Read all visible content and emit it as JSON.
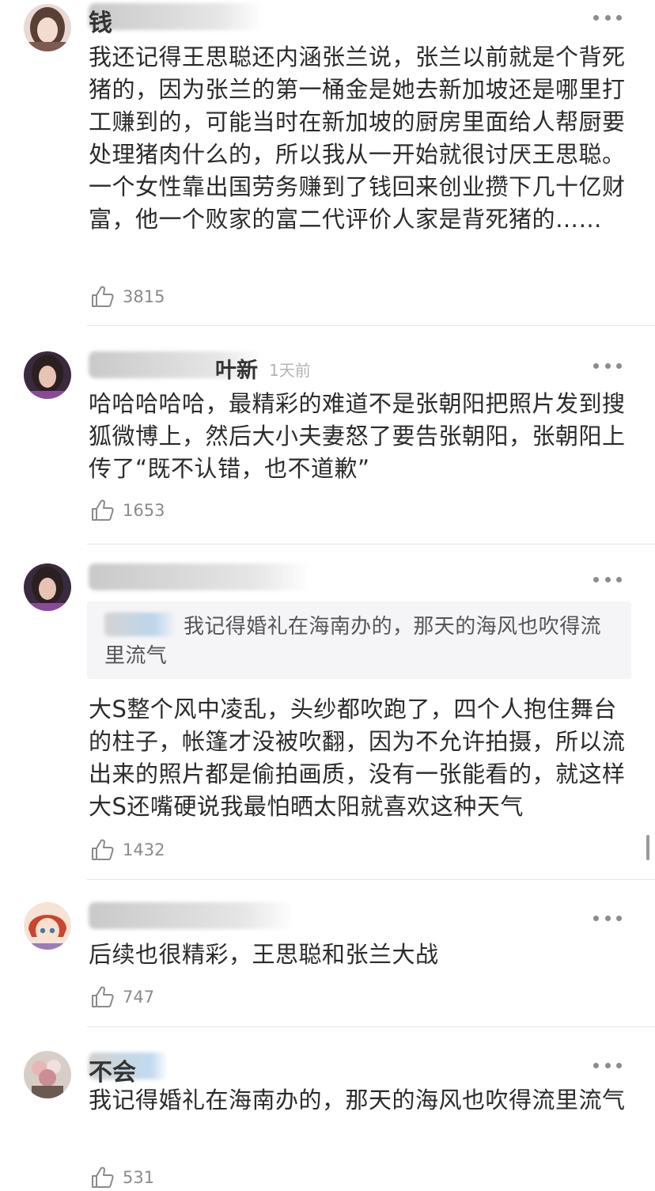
{
  "comments": [
    {
      "username_visible": "钱",
      "body": "我还记得王思聪还内涵张兰说，张兰以前就是个背死猪的，因为张兰的第一桶金是她去新加坡还是哪里打工赚到的，可能当时在新加坡的厨房里面给人帮厨要处理猪肉什么的，所以我从一开始就很讨厌王思聪。一个女性靠出国劳务赚到了钱回来创业攒下几十亿财富，他一个败家的富二代评价人家是背死猪的……",
      "likes": "3815"
    },
    {
      "username_visible": "叶新",
      "time": "1天前",
      "body": "哈哈哈哈哈，最精彩的难道不是张朝阳把照片发到搜狐微博上，然后大小夫妻怒了要告张朝阳，张朝阳上传了“既不认错，也不道歉”",
      "likes": "1653"
    },
    {
      "username_visible": "",
      "quote": "我记得婚礼在海南办的，那天的海风也吹得流里流气",
      "body": "大S整个风中凌乱，头纱都吹跑了，四个人抱住舞台的柱子，帐篷才没被吹翻，因为不允许拍摄，所以流出来的照片都是偷拍画质，没有一张能看的，就这样大S还嘴硬说我最怕晒太阳就喜欢这种天气",
      "likes": "1432"
    },
    {
      "username_visible": "",
      "body": "后续也很精彩，王思聪和张兰大战",
      "likes": "747"
    },
    {
      "username_visible": "不会",
      "body": "我记得婚礼在海南办的，那天的海风也吹得流里流气",
      "likes": "531"
    }
  ],
  "colors": {
    "text": "#2b2b2b",
    "muted": "#8a8a8a",
    "divider": "#e4e4e4",
    "quote_bg": "#f5f5f7"
  },
  "icons": {
    "like": "thumbs-up-icon",
    "more": "more-dots-icon"
  }
}
